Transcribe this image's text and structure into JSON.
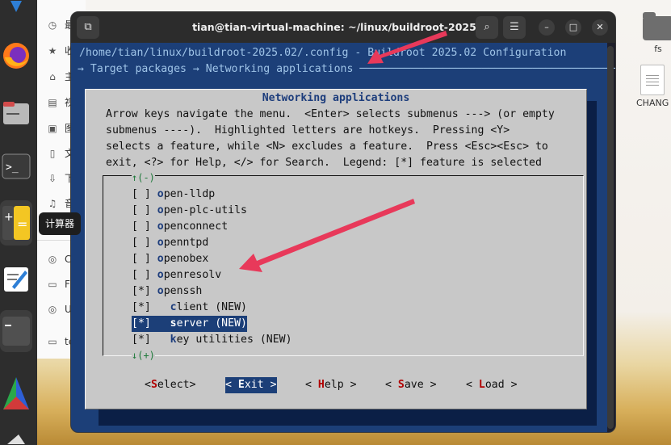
{
  "dock": {
    "calculator_tooltip": "计算器",
    "terminal_glyph": ">_",
    "calc_glyphs": [
      "+",
      "="
    ]
  },
  "file_manager": {
    "sidebar": [
      {
        "label": "最",
        "icon": "clock-icon"
      },
      {
        "label": "收",
        "icon": "star-icon"
      },
      {
        "label": "主",
        "icon": "home-icon"
      },
      {
        "label": "视",
        "icon": "video-icon"
      },
      {
        "label": "图",
        "icon": "image-icon"
      },
      {
        "label": "文",
        "icon": "document-icon"
      },
      {
        "label": "下",
        "icon": "download-icon"
      },
      {
        "label": "音",
        "icon": "music-icon"
      },
      {
        "label": "Ca",
        "icon": "disc-icon"
      },
      {
        "label": "Fl",
        "icon": "drive-icon"
      },
      {
        "label": "Ul",
        "icon": "disc-icon"
      },
      {
        "label": "te",
        "icon": "folder-icon"
      }
    ],
    "desktop": [
      {
        "label": "fs",
        "type": "folder"
      },
      {
        "label": "CHANG",
        "type": "document"
      }
    ]
  },
  "terminal": {
    "title": "tian@tian-virtual-machine: ~/linux/buildroot-2025.02",
    "buttons": {
      "new_tab": "⧉",
      "search": "⌕",
      "menu": "☰",
      "minimize": "–",
      "maximize": "□",
      "close": "✕"
    },
    "config_path": "/home/tian/linux/buildroot-2025.02/.config - Buildroot 2025.02 Configuration",
    "breadcrumb": "→ Target packages → Networking applications ─────────────────────────────────────────────"
  },
  "dialog": {
    "title": "Networking applications",
    "help_lines": [
      "Arrow keys navigate the menu.  <Enter> selects submenus ---> (or empty",
      "submenus ----).  Highlighted letters are hotkeys.  Pressing <Y>",
      "selects a feature, while <N> excludes a feature.  Press <Esc><Esc> to",
      "exit, <?> for Help, </> for Search.  Legend: [*] feature is selected"
    ],
    "scroll_up": "↑(-)",
    "scroll_down": "↓(+)",
    "items": [
      {
        "check": "[ ]",
        "indent": " ",
        "hot": "o",
        "rest": "pen-lldp",
        "selected": false
      },
      {
        "check": "[ ]",
        "indent": " ",
        "hot": "o",
        "rest": "pen-plc-utils",
        "selected": false
      },
      {
        "check": "[ ]",
        "indent": " ",
        "hot": "o",
        "rest": "penconnect",
        "selected": false
      },
      {
        "check": "[ ]",
        "indent": " ",
        "hot": "o",
        "rest": "penntpd",
        "selected": false
      },
      {
        "check": "[ ]",
        "indent": " ",
        "hot": "o",
        "rest": "penobex",
        "selected": false
      },
      {
        "check": "[ ]",
        "indent": " ",
        "hot": "o",
        "rest": "penresolv",
        "selected": false
      },
      {
        "check": "[*]",
        "indent": " ",
        "hot": "o",
        "rest": "penssh",
        "selected": false
      },
      {
        "check": "[*]",
        "indent": "   ",
        "hot": "c",
        "rest": "lient (NEW)",
        "selected": false
      },
      {
        "check": "[*]",
        "indent": "   ",
        "hot": "s",
        "rest": "erver (NEW)",
        "selected": true
      },
      {
        "check": "[*]",
        "indent": "   ",
        "hot": "k",
        "rest": "ey utilities (NEW)",
        "selected": false
      }
    ],
    "buttons": [
      {
        "pre": "<",
        "hot": "S",
        "post": "elect>",
        "active": false
      },
      {
        "pre": "< ",
        "hot": "E",
        "post": "xit >",
        "active": true
      },
      {
        "pre": "< ",
        "hot": "H",
        "post": "elp >",
        "active": false
      },
      {
        "pre": "< ",
        "hot": "S",
        "post": "ave >",
        "active": false
      },
      {
        "pre": "< ",
        "hot": "L",
        "post": "oad >",
        "active": false
      }
    ]
  },
  "annotations": {
    "arrow_color": "#e8395a"
  }
}
